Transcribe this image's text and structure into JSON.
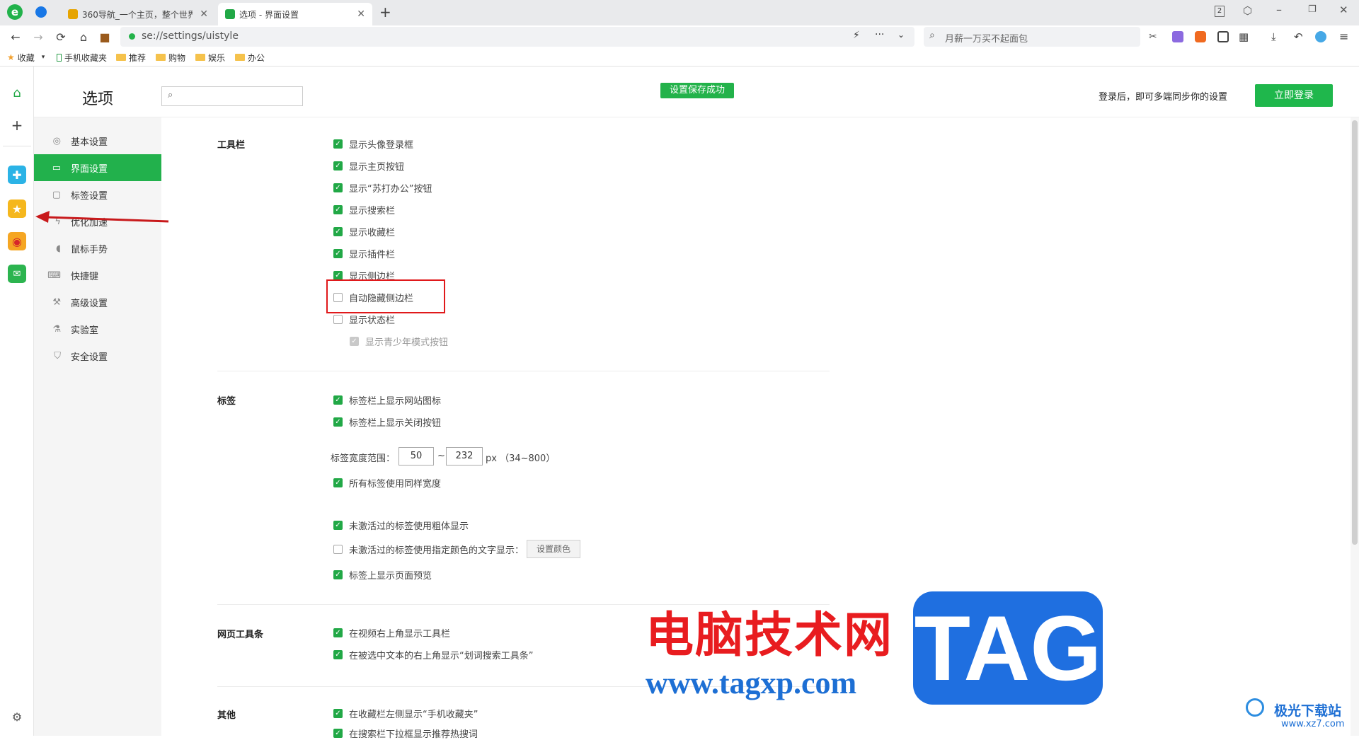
{
  "tabs": [
    {
      "title": "360导航_一个主页，整个世界",
      "icon_color": "#e6a400",
      "icon": "360-logo-icon"
    },
    {
      "title": "选项 - 界面设置",
      "icon_color": "#21a846",
      "icon": "settings-tab-icon"
    }
  ],
  "tab_counter": "2",
  "address": {
    "url": "se://settings/uistyle"
  },
  "search": {
    "placeholder": "月薪一万买不起面包"
  },
  "bookmarks": [
    {
      "label": "收藏",
      "icon": "star-icon"
    },
    {
      "label": "手机收藏夹",
      "icon": "phone-icon"
    },
    {
      "label": "推荐",
      "icon": "folder-icon"
    },
    {
      "label": "购物",
      "icon": "folder-icon"
    },
    {
      "label": "娱乐",
      "icon": "folder-icon"
    },
    {
      "label": "办公",
      "icon": "folder-icon"
    }
  ],
  "header": {
    "title": "选项",
    "toast": "设置保存成功",
    "sync_text": "登录后，即可多端同步你的设置",
    "login_button": "立即登录"
  },
  "sidebar": {
    "items": [
      {
        "label": "基本设置",
        "icon": "gear-icon"
      },
      {
        "label": "界面设置",
        "icon": "window-icon",
        "active": true
      },
      {
        "label": "标签设置",
        "icon": "tab-icon"
      },
      {
        "label": "优化加速",
        "icon": "bolt-icon"
      },
      {
        "label": "鼠标手势",
        "icon": "mouse-icon"
      },
      {
        "label": "快捷键",
        "icon": "keyboard-icon"
      },
      {
        "label": "高级设置",
        "icon": "wrench-icon"
      },
      {
        "label": "实验室",
        "icon": "flask-icon"
      },
      {
        "label": "安全设置",
        "icon": "shield-icon"
      }
    ]
  },
  "sections": {
    "toolbar": {
      "title": "工具栏",
      "options": [
        {
          "label": "显示头像登录框",
          "checked": true
        },
        {
          "label": "显示主页按钮",
          "checked": true
        },
        {
          "label": "显示“苏打办公”按钮",
          "checked": true
        },
        {
          "label": "显示搜索栏",
          "checked": true
        },
        {
          "label": "显示收藏栏",
          "checked": true
        },
        {
          "label": "显示插件栏",
          "checked": true
        },
        {
          "label": "显示侧边栏",
          "checked": true
        },
        {
          "label": "自动隐藏侧边栏",
          "checked": false
        },
        {
          "label": "显示状态栏",
          "checked": false
        },
        {
          "label": "显示青少年模式按钮",
          "checked": true,
          "disabled": true
        }
      ]
    },
    "tabs": {
      "title": "标签",
      "options": [
        {
          "label": "标签栏上显示网站图标",
          "checked": true
        },
        {
          "label": "标签栏上显示关闭按钮",
          "checked": true
        }
      ],
      "width_label": "标签宽度范围：",
      "width_min": "50",
      "width_sep": "~",
      "width_max": "232",
      "width_unit": "px （34~800）",
      "options2": [
        {
          "label": "所有标签使用同样宽度",
          "checked": true
        },
        {
          "label": "未激活过的标签使用粗体显示",
          "checked": true
        },
        {
          "label": "未激活过的标签使用指定颜色的文字显示：",
          "checked": false
        },
        {
          "label": "标签上显示页面预览",
          "checked": true
        }
      ],
      "color_button": "设置颜色"
    },
    "webtoolbar": {
      "title": "网页工具条",
      "options": [
        {
          "label": "在视频右上角显示工具栏",
          "checked": true
        },
        {
          "label": "在被选中文本的右上角显示“划词搜索工具条”",
          "checked": true
        }
      ]
    },
    "other": {
      "title": "其他",
      "options": [
        {
          "label": "在收藏栏左侧显示“手机收藏夹”",
          "checked": true
        },
        {
          "label": "在搜索栏下拉框显示推荐热搜词",
          "checked": true
        }
      ]
    }
  },
  "watermark": {
    "cn": "电脑技术网",
    "url": "www.tagxp.com",
    "tag": "TAG",
    "site": "极光下载站",
    "site_url": "www.xz7.com"
  },
  "colors": {
    "accent": "#21a846",
    "highlight": "#e0191b",
    "arrow": "#c8191b"
  }
}
